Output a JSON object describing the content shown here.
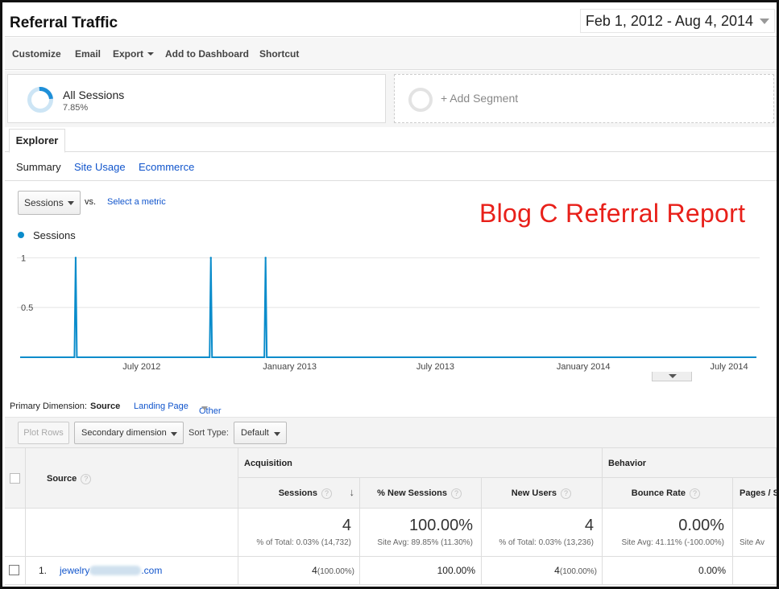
{
  "header": {
    "title": "Referral Traffic",
    "date_range": "Feb 1, 2012 - Aug 4, 2014"
  },
  "toolbar": {
    "customize": "Customize",
    "email": "Email",
    "export": "Export",
    "add_to_dashboard": "Add to Dashboard",
    "shortcut": "Shortcut"
  },
  "segments": {
    "active_name": "All Sessions",
    "active_pct": "7.85%",
    "add_label": "+ Add Segment"
  },
  "tabs": {
    "explorer": "Explorer",
    "summary": "Summary",
    "site_usage": "Site Usage",
    "ecommerce": "Ecommerce"
  },
  "chart_controls": {
    "metric": "Sessions",
    "vs": "vs.",
    "select_metric": "Select a metric",
    "overlay_title": "Blog C Referral Report",
    "legend": "Sessions"
  },
  "chart_data": {
    "type": "line",
    "series": [
      {
        "name": "Sessions",
        "color": "#0a8ccb",
        "spikes": [
          {
            "date": "2012-04-10",
            "value": 1
          },
          {
            "date": "2012-09-25",
            "value": 1
          },
          {
            "date": "2012-12-02",
            "value": 1
          }
        ],
        "baseline": 0
      }
    ],
    "x_range": [
      "2012-02-01",
      "2014-08-04"
    ],
    "x_ticks": [
      "July 2012",
      "January 2013",
      "July 2013",
      "January 2014",
      "July 2014"
    ],
    "y_ticks": [
      "1",
      "0.5"
    ],
    "ylim": [
      0,
      1.1
    ],
    "grid": true
  },
  "primary_dimension": {
    "label": "Primary Dimension:",
    "source": "Source",
    "landing_page": "Landing Page",
    "other": "Other"
  },
  "controls": {
    "plot_rows": "Plot Rows",
    "secondary_dimension": "Secondary dimension",
    "sort_type_label": "Sort Type:",
    "sort_type_value": "Default"
  },
  "table": {
    "source_header": "Source",
    "help_glyph": "?",
    "sort_glyph": "↓",
    "acquisition": "Acquisition",
    "behavior": "Behavior",
    "columns": [
      "Sessions",
      "% New Sessions",
      "New Users",
      "Bounce Rate",
      "Pages / S"
    ],
    "totals": {
      "sessions": "4",
      "sessions_sub": "% of Total: 0.03% (14,732)",
      "new_sessions": "100.00%",
      "new_sessions_sub": "Site Avg: 89.85% (11.30%)",
      "new_users": "4",
      "new_users_sub": "% of Total: 0.03% (13,236)",
      "bounce_rate": "0.00%",
      "bounce_rate_sub": "Site Avg: 41.11% (-100.00%)",
      "pages_sub": "Site Av"
    },
    "rows": [
      {
        "index": "1.",
        "source_prefix": "jewelry",
        "source_suffix": ".com",
        "sessions": "4",
        "sessions_pct": "(100.00%)",
        "new_sessions": "100.00%",
        "new_users": "4",
        "new_users_pct": "(100.00%)",
        "bounce_rate": "0.00%"
      }
    ]
  }
}
